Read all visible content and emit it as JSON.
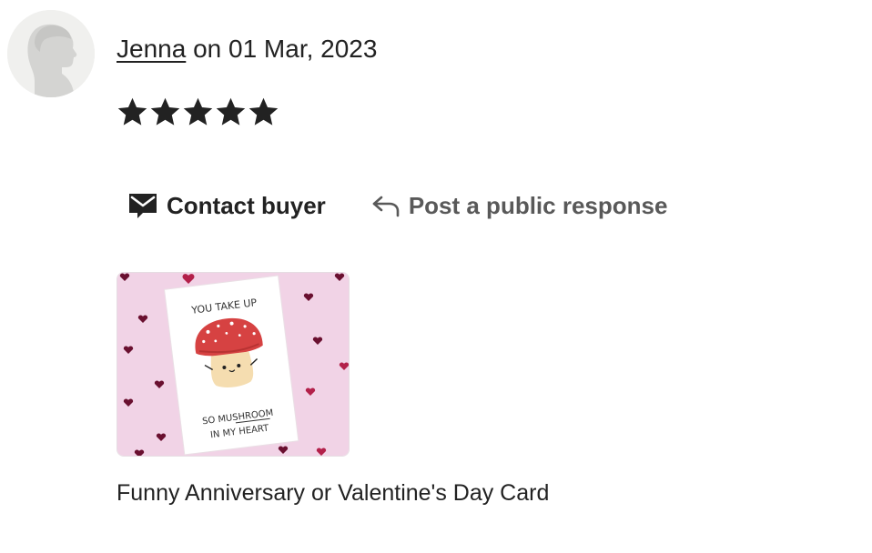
{
  "review": {
    "reviewer_name": "Jenna",
    "date_prefix": " on ",
    "date": "01 Mar, 2023",
    "rating": 5,
    "rating_max": 5
  },
  "actions": {
    "contact_label": "Contact buyer",
    "contact_icon": "envelope-icon",
    "respond_label": "Post a public response",
    "respond_icon": "reply-arrow-icon"
  },
  "product": {
    "title": "Funny Anniversary or Valentine's Day Card",
    "card_text_top": "YOU TAKE UP",
    "card_text_mid": "SO MUSHROOM",
    "card_text_bottom": "IN MY HEART"
  },
  "colors": {
    "text": "#222222",
    "muted": "#595959",
    "star": "#222222",
    "card_bg": "#f1d3e6",
    "mushroom_cap": "#d64242"
  }
}
